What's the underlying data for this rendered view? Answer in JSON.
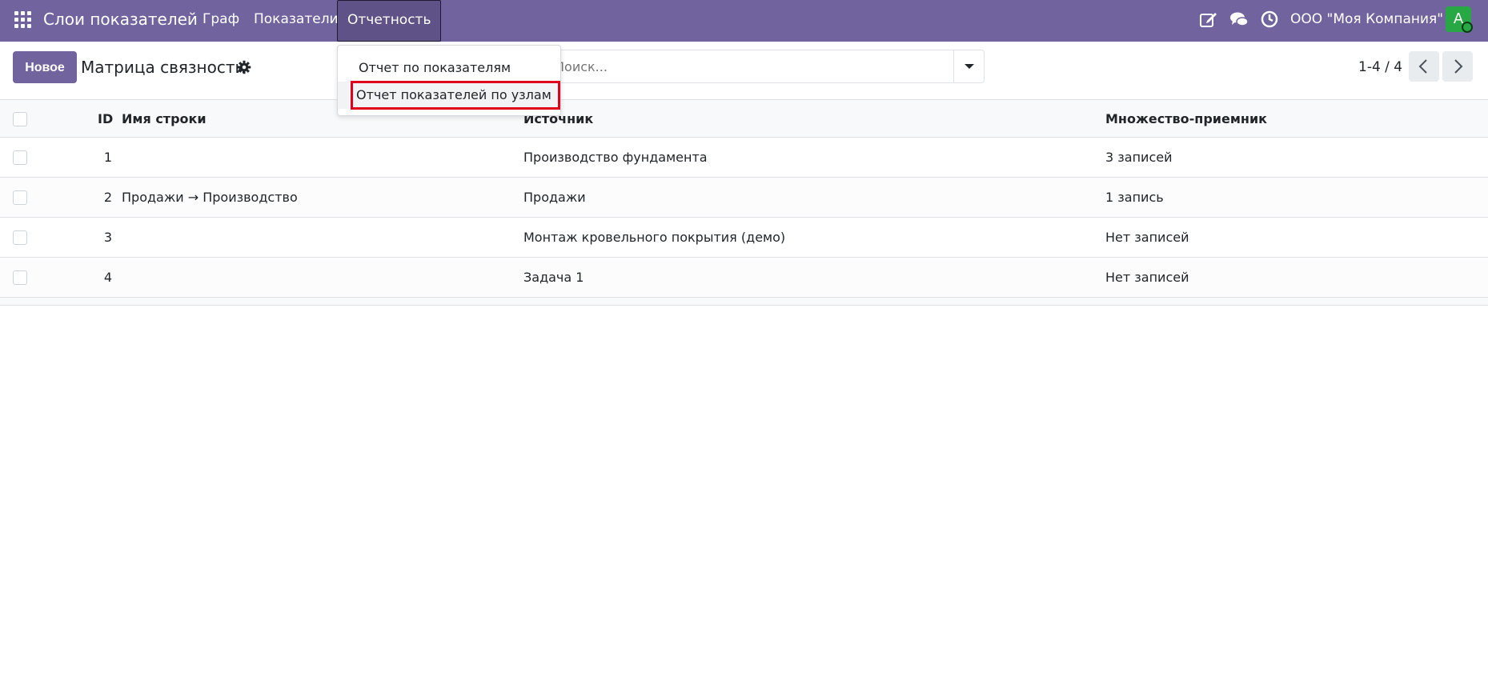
{
  "navbar": {
    "app_title": "Слои показателей",
    "menu": [
      "Граф",
      "Показатели",
      "Отчетность"
    ],
    "active_menu": "Отчетность",
    "company": "ООО \"Моя Компания\"",
    "avatar_letter": "A",
    "icons": [
      "apps-grid-icon",
      "edit-icon",
      "chat-icon",
      "clock-icon"
    ],
    "background_color": "#71639e"
  },
  "control_panel": {
    "new_button": "Новое",
    "view_title": "Матрица связности",
    "search_placeholder": "Поиск...",
    "pager": "1-4 / 4"
  },
  "dropdown": {
    "items": [
      "Отчет по показателям",
      "Отчет показателей по узлам"
    ],
    "highlighted_index": 1
  },
  "table": {
    "columns": [
      "ID",
      "Имя строки",
      "Источник",
      "Множество-приемник"
    ],
    "rows": [
      {
        "id": "1",
        "name": "",
        "source": "Производство фундамента",
        "target": "3 записей"
      },
      {
        "id": "2",
        "name": "Продажи → Производство",
        "source": "Продажи",
        "target": "1 запись"
      },
      {
        "id": "3",
        "name": "",
        "source": "Монтаж кровельного покрытия (демо)",
        "target": "Нет записей"
      },
      {
        "id": "4",
        "name": "",
        "source": "Задача 1",
        "target": "Нет записей"
      }
    ]
  }
}
